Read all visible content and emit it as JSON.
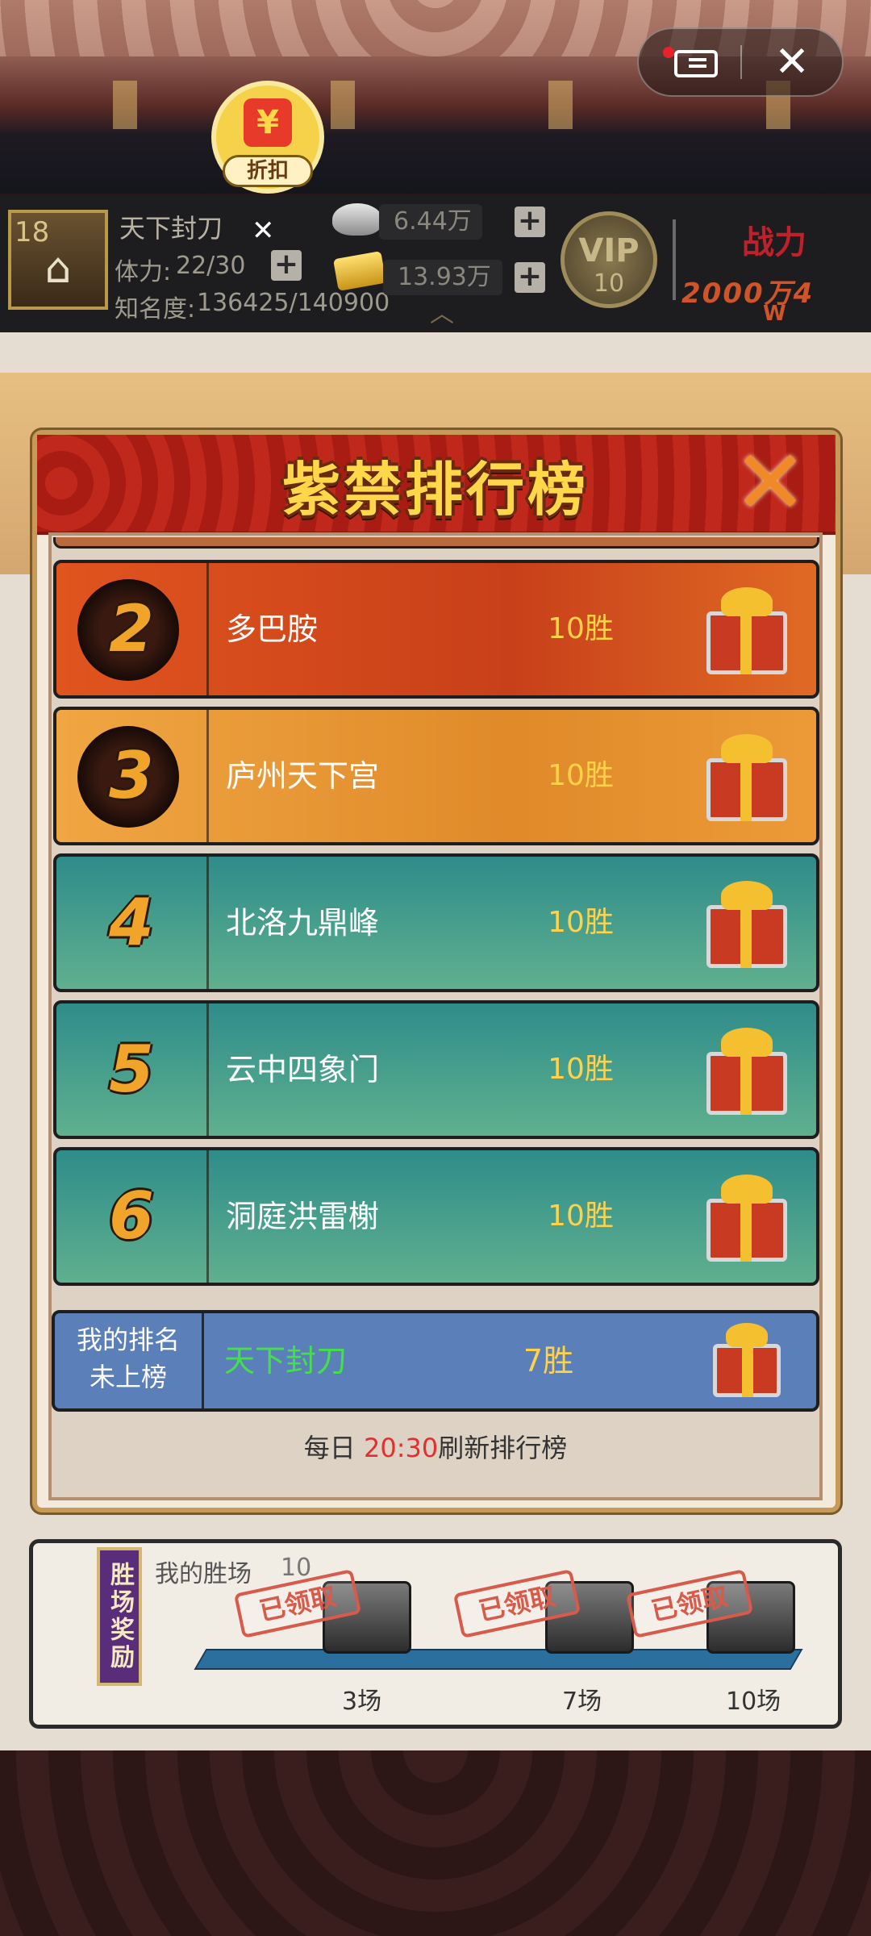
{
  "header": {
    "discount_label": "折扣",
    "player_name": "天下封刀",
    "level": "18",
    "stamina_label": "体力:",
    "stamina_value": "22/30",
    "fame_label": "知名度:",
    "fame_value": "136425/140900",
    "silver": "6.44万",
    "gold": "13.93万",
    "vip_label": "VIP",
    "vip_level": "10",
    "power_label": "战力",
    "power_value": "2000万4",
    "power_unit": "W"
  },
  "modal": {
    "title": "紫禁排行榜",
    "rows": [
      {
        "rank": "2",
        "name": "多巴胺",
        "wins": "10胜",
        "style": "red"
      },
      {
        "rank": "3",
        "name": "庐州天下宫",
        "wins": "10胜",
        "style": "orange"
      },
      {
        "rank": "4",
        "name": "北洛九鼎峰",
        "wins": "10胜",
        "style": "teal"
      },
      {
        "rank": "5",
        "name": "云中四象门",
        "wins": "10胜",
        "style": "teal"
      },
      {
        "rank": "6",
        "name": "洞庭洪雷榭",
        "wins": "10胜",
        "style": "teal"
      }
    ],
    "my_rank": {
      "label_line1": "我的排名",
      "label_line2": "未上榜",
      "name": "天下封刀",
      "wins": "7胜"
    },
    "refresh_prefix": "每日 ",
    "refresh_time": "20:30",
    "refresh_suffix": "刷新排行榜"
  },
  "reward_panel": {
    "tag": "胜场奖励",
    "my_wins_label": "我的胜场",
    "my_wins_value": "10",
    "claimed_stamp": "已领取",
    "milestones": [
      "3场",
      "7场",
      "10场"
    ]
  },
  "colors": {
    "rank_red": "#d8501c",
    "rank_orange": "#e89a34",
    "rank_teal": "#3f9a92",
    "my_row": "#5b7fb8"
  }
}
